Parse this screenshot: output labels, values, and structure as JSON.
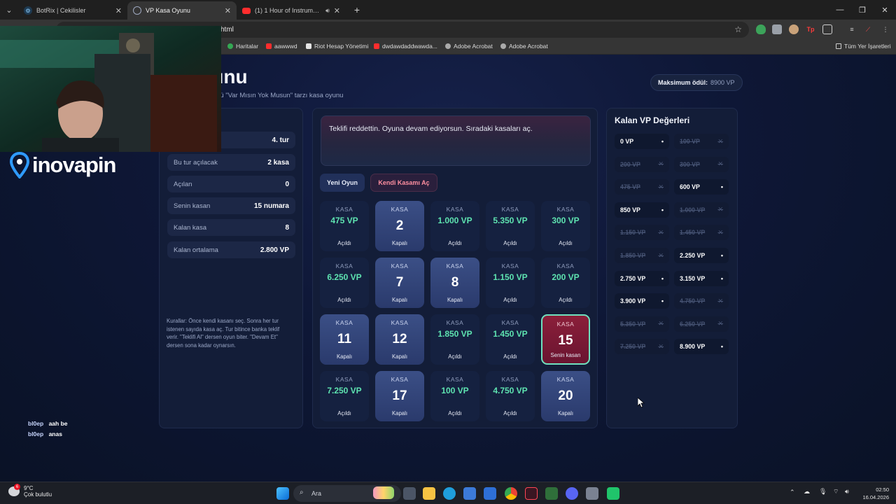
{
  "browser": {
    "tabs": [
      {
        "label": "BotRix | Cekilisler",
        "active": false,
        "icon": "gear-icon",
        "color": "#8fd0ff"
      },
      {
        "label": "VP Kasa Oyunu",
        "active": true,
        "icon": "globe-icon",
        "color": "#9fa9c0"
      },
      {
        "label": "(1) 1 Hour of Instrumental",
        "active": false,
        "icon": "youtube-icon",
        "color": "#ff2d2d"
      }
    ],
    "url": "html",
    "bookmarks": [
      {
        "label": "Haritalar",
        "color": "#34a853"
      },
      {
        "label": "aawwwd",
        "color": "#ff2d2d"
      },
      {
        "label": "Riot Hesap Yönetimi",
        "color": "#e5e5e5"
      },
      {
        "label": "dwdawdaddwawda...",
        "color": "#ff2d2d"
      },
      {
        "label": "Adobe Acrobat",
        "color": "#aaaaaa"
      },
      {
        "label": "Adobe Acrobat",
        "color": "#aaaaaa"
      }
    ],
    "all_bookmarks": "Tüm Yer İşaretleri"
  },
  "page": {
    "title": "sa Oyunu",
    "subtitle": "en, Valorant VP ödüllü \"Var Mısın Yok Musun\" tarzı kasa oyunu",
    "max_label": "Maksimum ödül:",
    "max_value": "8900 VP"
  },
  "left": {
    "heading_fragment": "u",
    "stats": [
      {
        "label": "",
        "value": "4. tur"
      },
      {
        "label": "Bu tur açılacak",
        "value": "2 kasa"
      },
      {
        "label": "Açılan",
        "value": "0"
      },
      {
        "label": "Senin kasan",
        "value": "15 numara"
      },
      {
        "label": "Kalan kasa",
        "value": "8"
      },
      {
        "label": "Kalan ortalama",
        "value": "2.800 VP"
      }
    ],
    "rules": "Kurallar: Önce kendi kasanı seç. Sonra her tur istenen sayıda kasa aç. Tur bitince banka teklif verir. \"Teklifi Al\" dersen oyun biter. \"Devam Et\" dersen sona kadar oynarsın."
  },
  "center": {
    "message": "Teklifi reddettin. Oyuna devam ediyorsun. Sıradaki kasaları aç.",
    "new_game": "Yeni Oyun",
    "open_own": "Kendi Kasamı Aç",
    "cases": [
      {
        "kasa": "KASA",
        "state": "opened",
        "main": "475 VP",
        "status": "Açıldı"
      },
      {
        "kasa": "KASA",
        "state": "closed",
        "main": "2",
        "status": "Kapalı"
      },
      {
        "kasa": "KASA",
        "state": "opened",
        "main": "1.000 VP",
        "status": "Açıldı"
      },
      {
        "kasa": "KASA",
        "state": "opened",
        "main": "5.350 VP",
        "status": "Açıldı"
      },
      {
        "kasa": "KASA",
        "state": "opened",
        "main": "300 VP",
        "status": "Açıldı"
      },
      {
        "kasa": "KASA",
        "state": "opened",
        "main": "6.250 VP",
        "status": "Açıldı"
      },
      {
        "kasa": "KASA",
        "state": "closed",
        "main": "7",
        "status": "Kapalı"
      },
      {
        "kasa": "KASA",
        "state": "closed",
        "main": "8",
        "status": "Kapalı"
      },
      {
        "kasa": "KASA",
        "state": "opened",
        "main": "1.150 VP",
        "status": "Açıldı"
      },
      {
        "kasa": "KASA",
        "state": "opened",
        "main": "200 VP",
        "status": "Açıldı"
      },
      {
        "kasa": "KASA",
        "state": "closed",
        "main": "11",
        "status": "Kapalı"
      },
      {
        "kasa": "KASA",
        "state": "closed",
        "main": "12",
        "status": "Kapalı"
      },
      {
        "kasa": "KASA",
        "state": "opened",
        "main": "1.850 VP",
        "status": "Açıldı"
      },
      {
        "kasa": "KASA",
        "state": "opened",
        "main": "1.450 VP",
        "status": "Açıldı"
      },
      {
        "kasa": "KASA",
        "state": "mine",
        "main": "15",
        "status": "Senin kasan"
      },
      {
        "kasa": "KASA",
        "state": "opened",
        "main": "7.250 VP",
        "status": "Açıldı"
      },
      {
        "kasa": "KASA",
        "state": "closed",
        "main": "17",
        "status": "Kapalı"
      },
      {
        "kasa": "KASA",
        "state": "opened",
        "main": "100 VP",
        "status": "Açıldı"
      },
      {
        "kasa": "KASA",
        "state": "opened",
        "main": "4.750 VP",
        "status": "Açıldı"
      },
      {
        "kasa": "KASA",
        "state": "closed",
        "main": "20",
        "status": "Kapalı"
      }
    ]
  },
  "right": {
    "title": "Kalan VP Değerleri",
    "values": [
      {
        "label": "0 VP",
        "live": true,
        "mark": "•"
      },
      {
        "label": "100 VP",
        "live": false,
        "mark": "✕"
      },
      {
        "label": "200 VP",
        "live": false,
        "mark": "✕"
      },
      {
        "label": "300 VP",
        "live": false,
        "mark": "✕"
      },
      {
        "label": "475 VP",
        "live": false,
        "mark": "✕"
      },
      {
        "label": "600 VP",
        "live": true,
        "mark": "•"
      },
      {
        "label": "850 VP",
        "live": true,
        "mark": "•"
      },
      {
        "label": "1.000 VP",
        "live": false,
        "mark": "✕"
      },
      {
        "label": "1.150 VP",
        "live": false,
        "mark": "✕"
      },
      {
        "label": "1.450 VP",
        "live": false,
        "mark": "✕"
      },
      {
        "label": "1.850 VP",
        "live": false,
        "mark": "✕"
      },
      {
        "label": "2.250 VP",
        "live": true,
        "mark": "•"
      },
      {
        "label": "2.750 VP",
        "live": true,
        "mark": "•"
      },
      {
        "label": "3.150 VP",
        "live": true,
        "mark": "•"
      },
      {
        "label": "3.900 VP",
        "live": true,
        "mark": "•"
      },
      {
        "label": "4.750 VP",
        "live": false,
        "mark": "✕"
      },
      {
        "label": "5.350 VP",
        "live": false,
        "mark": "✕"
      },
      {
        "label": "6.250 VP",
        "live": false,
        "mark": "✕"
      },
      {
        "label": "7.250 VP",
        "live": false,
        "mark": "✕"
      },
      {
        "label": "8.900 VP",
        "live": true,
        "mark": "•"
      }
    ]
  },
  "overlay": {
    "logo": "inovapin",
    "chat": [
      {
        "user": "bl0ep",
        "msg": "aah be"
      },
      {
        "user": "bl0ep",
        "msg": "anas"
      }
    ]
  },
  "taskbar": {
    "temp": "9°C",
    "weather": "Çok bulutlu",
    "search": "Ara",
    "time": "02:50",
    "date": "16.04.2026",
    "notif_count": "6"
  }
}
